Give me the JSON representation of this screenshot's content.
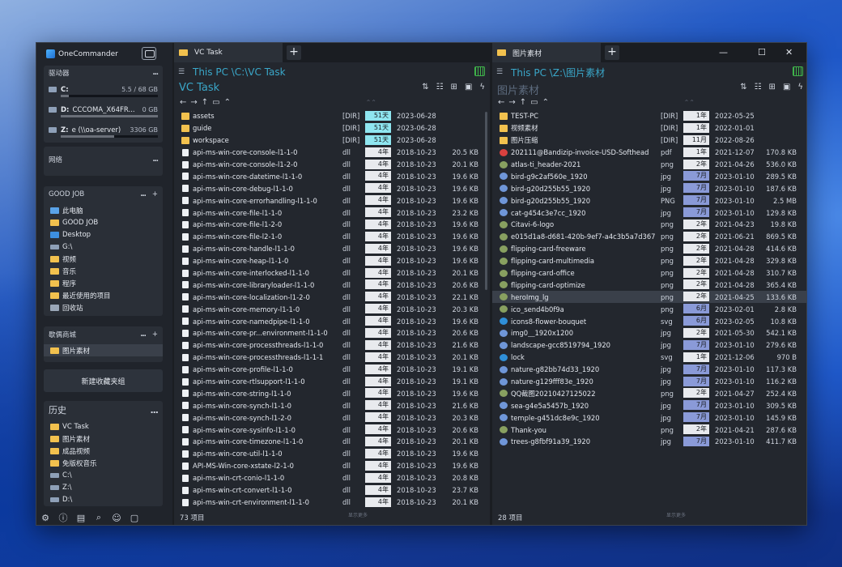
{
  "app": {
    "title": "OneCommander"
  },
  "sidebar": {
    "drives_title": "驱动器",
    "drives": [
      {
        "letter": "C:",
        "name": "",
        "size": "5.5 / 68 GB",
        "used": 0.08
      },
      {
        "letter": "D:",
        "name": "CCCOMA_X64FR...",
        "size": "0 GB",
        "used": 1.0
      },
      {
        "letter": "Z:",
        "name": "e (\\\\oa-server)",
        "size": "3306 GB",
        "used": 0.55
      }
    ],
    "network_title": "网络",
    "goodjob": {
      "title": "GOOD JOB",
      "items": [
        {
          "label": "此电脑",
          "icon": "pc"
        },
        {
          "label": "GOOD JOB",
          "icon": "folder"
        },
        {
          "label": "Desktop",
          "icon": "dsk"
        },
        {
          "label": "G:\\",
          "icon": "drv"
        },
        {
          "label": "视频",
          "icon": "folder"
        },
        {
          "label": "音乐",
          "icon": "folder"
        },
        {
          "label": "程序",
          "icon": "folder"
        },
        {
          "label": "最近使用的项目",
          "icon": "folder"
        },
        {
          "label": "回收站",
          "icon": "bin"
        }
      ]
    },
    "favs": {
      "title": "歇偶商城",
      "items": [
        {
          "label": "图片素材",
          "icon": "folder"
        }
      ]
    },
    "new_group": "新建收藏夹组",
    "history": {
      "title": "历史",
      "items": [
        {
          "label": "VC Task",
          "icon": "folder"
        },
        {
          "label": "图片素材",
          "icon": "folder"
        },
        {
          "label": "成品视频",
          "icon": "folder"
        },
        {
          "label": "免版权音乐",
          "icon": "folder"
        },
        {
          "label": "C:\\",
          "icon": "drv"
        },
        {
          "label": "Z:\\",
          "icon": "drv"
        },
        {
          "label": "D:\\",
          "icon": "drv"
        }
      ]
    },
    "dots": "...",
    "plus": "+"
  },
  "colors": {
    "age_cyan": "#8fe6f0",
    "age_gray": "#e8eaee",
    "age_blue": "#8a9ad8",
    "accent": "#3aa7c9"
  },
  "left": {
    "tab": "VC Task",
    "path": "This PC \\C:\\VC Task",
    "title": "VC Task",
    "status": "73 项目",
    "status_mid": "显示更多",
    "rows": [
      {
        "n": "assets",
        "t": "[DIR]",
        "a": "51天",
        "d": "2023-06-28",
        "s": "",
        "ic": "folder",
        "c": "cyan"
      },
      {
        "n": "guide",
        "t": "[DIR]",
        "a": "51天",
        "d": "2023-06-28",
        "s": "",
        "ic": "folder",
        "c": "cyan"
      },
      {
        "n": "workspace",
        "t": "[DIR]",
        "a": "51天",
        "d": "2023-06-28",
        "s": "",
        "ic": "folder",
        "c": "cyan"
      },
      {
        "n": "api-ms-win-core-console-l1-1-0",
        "t": "dll",
        "a": "4年",
        "d": "2018-10-23",
        "s": "20.5 KB",
        "ic": "dll",
        "c": "gray"
      },
      {
        "n": "api-ms-win-core-console-l1-2-0",
        "t": "dll",
        "a": "4年",
        "d": "2018-10-23",
        "s": "20.1 KB",
        "ic": "dll",
        "c": "gray"
      },
      {
        "n": "api-ms-win-core-datetime-l1-1-0",
        "t": "dll",
        "a": "4年",
        "d": "2018-10-23",
        "s": "19.6 KB",
        "ic": "dll",
        "c": "gray"
      },
      {
        "n": "api-ms-win-core-debug-l1-1-0",
        "t": "dll",
        "a": "4年",
        "d": "2018-10-23",
        "s": "19.6 KB",
        "ic": "dll",
        "c": "gray"
      },
      {
        "n": "api-ms-win-core-errorhandling-l1-1-0",
        "t": "dll",
        "a": "4年",
        "d": "2018-10-23",
        "s": "19.6 KB",
        "ic": "dll",
        "c": "gray"
      },
      {
        "n": "api-ms-win-core-file-l1-1-0",
        "t": "dll",
        "a": "4年",
        "d": "2018-10-23",
        "s": "23.2 KB",
        "ic": "dll",
        "c": "gray"
      },
      {
        "n": "api-ms-win-core-file-l1-2-0",
        "t": "dll",
        "a": "4年",
        "d": "2018-10-23",
        "s": "19.6 KB",
        "ic": "dll",
        "c": "gray"
      },
      {
        "n": "api-ms-win-core-file-l2-1-0",
        "t": "dll",
        "a": "4年",
        "d": "2018-10-23",
        "s": "19.6 KB",
        "ic": "dll",
        "c": "gray"
      },
      {
        "n": "api-ms-win-core-handle-l1-1-0",
        "t": "dll",
        "a": "4年",
        "d": "2018-10-23",
        "s": "19.6 KB",
        "ic": "dll",
        "c": "gray"
      },
      {
        "n": "api-ms-win-core-heap-l1-1-0",
        "t": "dll",
        "a": "4年",
        "d": "2018-10-23",
        "s": "19.6 KB",
        "ic": "dll",
        "c": "gray"
      },
      {
        "n": "api-ms-win-core-interlocked-l1-1-0",
        "t": "dll",
        "a": "4年",
        "d": "2018-10-23",
        "s": "20.1 KB",
        "ic": "dll",
        "c": "gray"
      },
      {
        "n": "api-ms-win-core-libraryloader-l1-1-0",
        "t": "dll",
        "a": "4年",
        "d": "2018-10-23",
        "s": "20.6 KB",
        "ic": "dll",
        "c": "gray"
      },
      {
        "n": "api-ms-win-core-localization-l1-2-0",
        "t": "dll",
        "a": "4年",
        "d": "2018-10-23",
        "s": "22.1 KB",
        "ic": "dll",
        "c": "gray"
      },
      {
        "n": "api-ms-win-core-memory-l1-1-0",
        "t": "dll",
        "a": "4年",
        "d": "2018-10-23",
        "s": "20.3 KB",
        "ic": "dll",
        "c": "gray"
      },
      {
        "n": "api-ms-win-core-namedpipe-l1-1-0",
        "t": "dll",
        "a": "4年",
        "d": "2018-10-23",
        "s": "19.6 KB",
        "ic": "dll",
        "c": "gray"
      },
      {
        "n": "api-ms-win-core-pr...environment-l1-1-0",
        "t": "dll",
        "a": "4年",
        "d": "2018-10-23",
        "s": "20.6 KB",
        "ic": "dll",
        "c": "gray"
      },
      {
        "n": "api-ms-win-core-processthreads-l1-1-0",
        "t": "dll",
        "a": "4年",
        "d": "2018-10-23",
        "s": "21.6 KB",
        "ic": "dll",
        "c": "gray"
      },
      {
        "n": "api-ms-win-core-processthreads-l1-1-1",
        "t": "dll",
        "a": "4年",
        "d": "2018-10-23",
        "s": "20.1 KB",
        "ic": "dll",
        "c": "gray"
      },
      {
        "n": "api-ms-win-core-profile-l1-1-0",
        "t": "dll",
        "a": "4年",
        "d": "2018-10-23",
        "s": "19.1 KB",
        "ic": "dll",
        "c": "gray"
      },
      {
        "n": "api-ms-win-core-rtlsupport-l1-1-0",
        "t": "dll",
        "a": "4年",
        "d": "2018-10-23",
        "s": "19.1 KB",
        "ic": "dll",
        "c": "gray"
      },
      {
        "n": "api-ms-win-core-string-l1-1-0",
        "t": "dll",
        "a": "4年",
        "d": "2018-10-23",
        "s": "19.6 KB",
        "ic": "dll",
        "c": "gray"
      },
      {
        "n": "api-ms-win-core-synch-l1-1-0",
        "t": "dll",
        "a": "4年",
        "d": "2018-10-23",
        "s": "21.6 KB",
        "ic": "dll",
        "c": "gray"
      },
      {
        "n": "api-ms-win-core-synch-l1-2-0",
        "t": "dll",
        "a": "4年",
        "d": "2018-10-23",
        "s": "20.3 KB",
        "ic": "dll",
        "c": "gray"
      },
      {
        "n": "api-ms-win-core-sysinfo-l1-1-0",
        "t": "dll",
        "a": "4年",
        "d": "2018-10-23",
        "s": "20.6 KB",
        "ic": "dll",
        "c": "gray"
      },
      {
        "n": "api-ms-win-core-timezone-l1-1-0",
        "t": "dll",
        "a": "4年",
        "d": "2018-10-23",
        "s": "20.1 KB",
        "ic": "dll",
        "c": "gray"
      },
      {
        "n": "api-ms-win-core-util-l1-1-0",
        "t": "dll",
        "a": "4年",
        "d": "2018-10-23",
        "s": "19.6 KB",
        "ic": "dll",
        "c": "gray"
      },
      {
        "n": "API-MS-Win-core-xstate-l2-1-0",
        "t": "dll",
        "a": "4年",
        "d": "2018-10-23",
        "s": "19.6 KB",
        "ic": "dll",
        "c": "gray"
      },
      {
        "n": "api-ms-win-crt-conio-l1-1-0",
        "t": "dll",
        "a": "4年",
        "d": "2018-10-23",
        "s": "20.8 KB",
        "ic": "dll",
        "c": "gray"
      },
      {
        "n": "api-ms-win-crt-convert-l1-1-0",
        "t": "dll",
        "a": "4年",
        "d": "2018-10-23",
        "s": "23.7 KB",
        "ic": "dll",
        "c": "gray"
      },
      {
        "n": "api-ms-win-crt-environment-l1-1-0",
        "t": "dll",
        "a": "4年",
        "d": "2018-10-23",
        "s": "20.1 KB",
        "ic": "dll",
        "c": "gray"
      }
    ]
  },
  "right": {
    "tab": "图片素材",
    "path": "This PC \\Z:\\图片素材",
    "title": "图片素材",
    "status": "28 项目",
    "status_mid": "显示更多",
    "minimize": "—",
    "maximize": "☐",
    "close": "✕",
    "rows": [
      {
        "n": "TEST-PC",
        "t": "[DIR]",
        "a": "1年",
        "d": "2022-05-25",
        "s": "",
        "ic": "folder",
        "c": "gray"
      },
      {
        "n": "视频素材",
        "t": "[DIR]",
        "a": "1年",
        "d": "2022-01-01",
        "s": "",
        "ic": "folder",
        "c": "gray"
      },
      {
        "n": "图片压缩",
        "t": "[DIR]",
        "a": "11月",
        "d": "2022-08-26",
        "s": "",
        "ic": "folder",
        "c": "gray"
      },
      {
        "n": "202111@Bandizip-invoice-USD-Softhead",
        "t": "pdf",
        "a": "1年",
        "d": "2021-12-07",
        "s": "170.8 KB",
        "ic": "pdf",
        "c": "gray"
      },
      {
        "n": "atlas-ti_header-2021",
        "t": "png",
        "a": "2年",
        "d": "2021-04-26",
        "s": "536.0 KB",
        "ic": "png",
        "c": "gray"
      },
      {
        "n": "bird-g9c2af560e_1920",
        "t": "jpg",
        "a": "7月",
        "d": "2023-01-10",
        "s": "289.5 KB",
        "ic": "img",
        "c": "blue"
      },
      {
        "n": "bird-g20d255b55_1920",
        "t": "jpg",
        "a": "7月",
        "d": "2023-01-10",
        "s": "187.6 KB",
        "ic": "img",
        "c": "blue"
      },
      {
        "n": "bird-g20d255b55_1920",
        "t": "PNG",
        "a": "7月",
        "d": "2023-01-10",
        "s": "2.5 MB",
        "ic": "img",
        "c": "blue"
      },
      {
        "n": "cat-g454c3e7cc_1920",
        "t": "jpg",
        "a": "7月",
        "d": "2023-01-10",
        "s": "129.8 KB",
        "ic": "img",
        "c": "blue"
      },
      {
        "n": "Citavi-6-logo",
        "t": "png",
        "a": "2年",
        "d": "2021-04-23",
        "s": "19.8 KB",
        "ic": "png",
        "c": "gray"
      },
      {
        "n": "e015d1a8-d681-420b-9ef7-a4c3b5a7d367",
        "t": "png",
        "a": "2年",
        "d": "2021-06-21",
        "s": "869.5 KB",
        "ic": "png",
        "c": "gray"
      },
      {
        "n": "flipping-card-freeware",
        "t": "png",
        "a": "2年",
        "d": "2021-04-28",
        "s": "414.6 KB",
        "ic": "png",
        "c": "gray"
      },
      {
        "n": "flipping-card-multimedia",
        "t": "png",
        "a": "2年",
        "d": "2021-04-28",
        "s": "329.8 KB",
        "ic": "png",
        "c": "gray"
      },
      {
        "n": "flipping-card-office",
        "t": "png",
        "a": "2年",
        "d": "2021-04-28",
        "s": "310.7 KB",
        "ic": "png",
        "c": "gray"
      },
      {
        "n": "flipping-card-optimize",
        "t": "png",
        "a": "2年",
        "d": "2021-04-28",
        "s": "365.4 KB",
        "ic": "png",
        "c": "gray"
      },
      {
        "n": "heroImg_lg",
        "t": "png",
        "a": "2年",
        "d": "2021-04-25",
        "s": "133.6 KB",
        "ic": "png",
        "c": "gray",
        "sel": true
      },
      {
        "n": "ico_send4b0f9a",
        "t": "png",
        "a": "6月",
        "d": "2023-02-01",
        "s": "2.8 KB",
        "ic": "png",
        "c": "blue"
      },
      {
        "n": "icons8-flower-bouquet",
        "t": "svg",
        "a": "6月",
        "d": "2023-02-05",
        "s": "10.8 KB",
        "ic": "svg",
        "c": "blue"
      },
      {
        "n": "img0__1920x1200",
        "t": "jpg",
        "a": "2年",
        "d": "2021-05-30",
        "s": "542.1 KB",
        "ic": "img",
        "c": "gray"
      },
      {
        "n": "landscape-gcc8519794_1920",
        "t": "jpg",
        "a": "7月",
        "d": "2023-01-10",
        "s": "279.6 KB",
        "ic": "img",
        "c": "blue"
      },
      {
        "n": "lock",
        "t": "svg",
        "a": "1年",
        "d": "2021-12-06",
        "s": "970 B",
        "ic": "svg",
        "c": "gray"
      },
      {
        "n": "nature-g82bb74d33_1920",
        "t": "jpg",
        "a": "7月",
        "d": "2023-01-10",
        "s": "117.3 KB",
        "ic": "img",
        "c": "blue"
      },
      {
        "n": "nature-g129fff83e_1920",
        "t": "jpg",
        "a": "7月",
        "d": "2023-01-10",
        "s": "116.2 KB",
        "ic": "img",
        "c": "blue"
      },
      {
        "n": "QQ截图20210427125022",
        "t": "png",
        "a": "2年",
        "d": "2021-04-27",
        "s": "252.4 KB",
        "ic": "png",
        "c": "gray"
      },
      {
        "n": "sea-g4e5a5457b_1920",
        "t": "jpg",
        "a": "7月",
        "d": "2023-01-10",
        "s": "309.5 KB",
        "ic": "img",
        "c": "blue"
      },
      {
        "n": "temple-g451dc8e9c_1920",
        "t": "jpg",
        "a": "7月",
        "d": "2023-01-10",
        "s": "145.9 KB",
        "ic": "img",
        "c": "blue"
      },
      {
        "n": "Thank-you",
        "t": "png",
        "a": "2年",
        "d": "2021-04-21",
        "s": "287.6 KB",
        "ic": "png",
        "c": "gray"
      },
      {
        "n": "trees-g8fbf91a39_1920",
        "t": "jpg",
        "a": "7月",
        "d": "2023-01-10",
        "s": "411.7 KB",
        "ic": "img",
        "c": "blue"
      }
    ]
  }
}
